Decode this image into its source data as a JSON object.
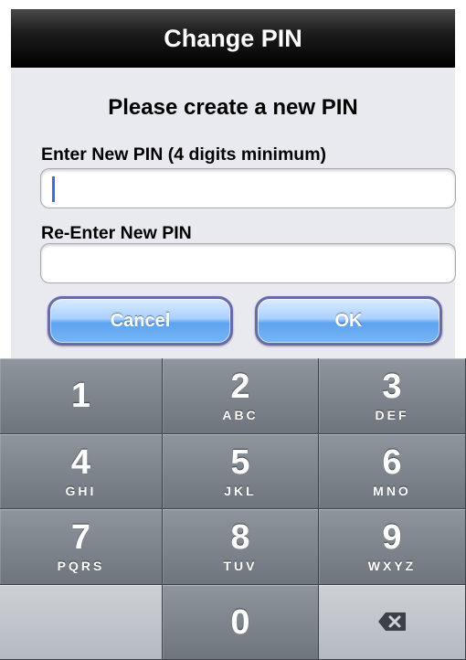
{
  "header": {
    "title": "Change PIN"
  },
  "form": {
    "heading": "Please create a new PIN",
    "new_pin_label": "Enter New PIN (4 digits minimum)",
    "new_pin_value": "",
    "reenter_label": "Re-Enter New PIN",
    "reenter_value": "",
    "cancel_label": "Cancel",
    "ok_label": "OK"
  },
  "keypad": {
    "keys": [
      {
        "digit": "1",
        "letters": ""
      },
      {
        "digit": "2",
        "letters": "ABC"
      },
      {
        "digit": "3",
        "letters": "DEF"
      },
      {
        "digit": "4",
        "letters": "GHI"
      },
      {
        "digit": "5",
        "letters": "JKL"
      },
      {
        "digit": "6",
        "letters": "MNO"
      },
      {
        "digit": "7",
        "letters": "PQRS"
      },
      {
        "digit": "8",
        "letters": "TUV"
      },
      {
        "digit": "9",
        "letters": "WXYZ"
      },
      {
        "digit": "0",
        "letters": ""
      }
    ],
    "delete_icon": "backspace-icon"
  },
  "colors": {
    "title_bar": "#000000",
    "form_bg": "#e9e9f0",
    "button_blue": "#5da3f0",
    "key_gray": "#7a8088",
    "caret": "#3f6be0"
  }
}
